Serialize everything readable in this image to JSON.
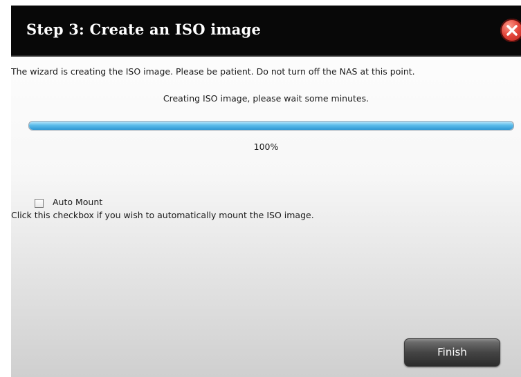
{
  "dialog": {
    "title": "Step 3: Create an ISO image",
    "intro": "The wizard is creating the ISO image. Please be patient. Do not turn off the NAS at this point.",
    "status": "Creating ISO image, please wait some minutes.",
    "progress": {
      "value_percent": 100,
      "label": "100%",
      "fill_color": "#4fb3e6"
    },
    "auto_mount": {
      "label": "Auto Mount",
      "checked": false,
      "help": "Click this checkbox if you wish to automatically mount the ISO image."
    },
    "buttons": {
      "finish_label": "Finish",
      "close_icon": "close-icon"
    },
    "colors": {
      "titlebar_bg": "#080808",
      "title_text": "#ffffff",
      "close_button": "#e2453a"
    }
  }
}
